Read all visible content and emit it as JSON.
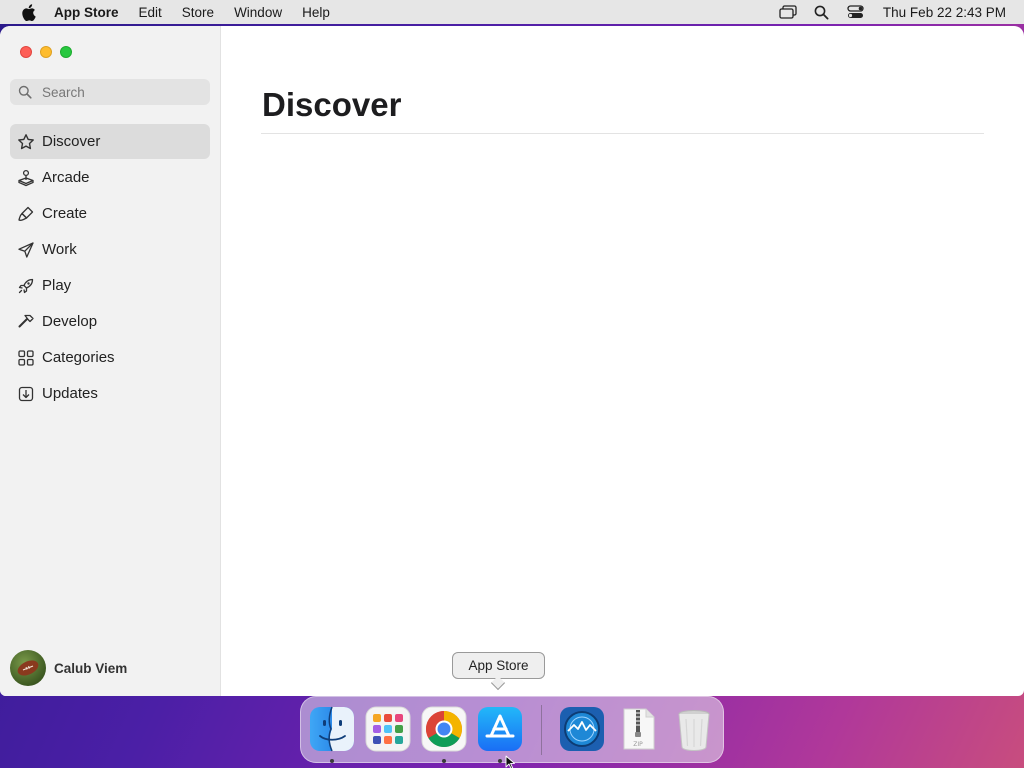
{
  "menubar": {
    "apple_icon": "apple-logo-icon",
    "app_name": "App Store",
    "items": [
      "Edit",
      "Store",
      "Window",
      "Help"
    ],
    "status_icons": [
      "screen-mirroring-icon",
      "spotlight-search-icon",
      "control-center-icon"
    ],
    "clock": "Thu Feb 22  2:43 PM"
  },
  "sidebar": {
    "search": {
      "placeholder": "Search",
      "value": ""
    },
    "items": [
      {
        "label": "Discover",
        "icon": "star-icon",
        "active": true
      },
      {
        "label": "Arcade",
        "icon": "joystick-icon",
        "active": false
      },
      {
        "label": "Create",
        "icon": "brush-icon",
        "active": false
      },
      {
        "label": "Work",
        "icon": "paper-plane-icon",
        "active": false
      },
      {
        "label": "Play",
        "icon": "rocket-icon",
        "active": false
      },
      {
        "label": "Develop",
        "icon": "hammer-icon",
        "active": false
      },
      {
        "label": "Categories",
        "icon": "grid-icon",
        "active": false
      },
      {
        "label": "Updates",
        "icon": "download-icon",
        "active": false
      }
    ],
    "user": {
      "name": "Calub Viem"
    }
  },
  "main": {
    "title": "Discover"
  },
  "dock": {
    "tooltip": "App Store",
    "apps": [
      "finder-icon",
      "launchpad-icon",
      "chrome-icon",
      "app-store-icon",
      "system-monitor-icon",
      "zip-archive-icon",
      "trash-icon"
    ],
    "running": [
      "finder-icon",
      "chrome-icon",
      "app-store-icon"
    ]
  },
  "colors": {
    "close": "#fe5f57",
    "minimize": "#febc2e",
    "maximize": "#28c840",
    "sidebar_active": "#dcdcdc",
    "app_store_blue": "#1a7cf5"
  }
}
